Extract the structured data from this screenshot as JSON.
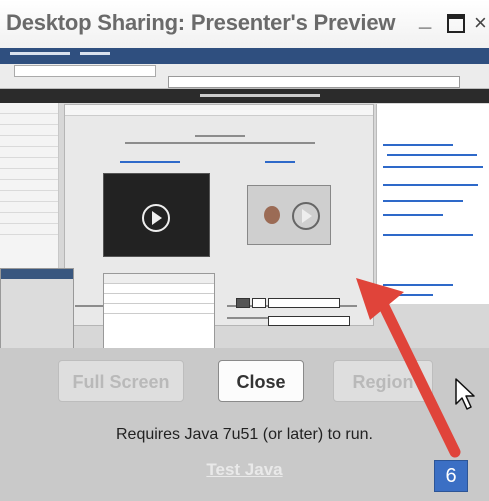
{
  "window": {
    "title": "Desktop Sharing: Presenter's Preview",
    "minimize_symbol": "_",
    "close_symbol": "×"
  },
  "controls": {
    "full_screen_label": "Full Screen",
    "close_label": "Close",
    "region_label": "Region",
    "requirement_text": "Requires Java 7u51 (or later) to run.",
    "test_java_link": "Test Java"
  },
  "annotation": {
    "step_number": "6",
    "arrow_color": "#e0443a",
    "badge_color": "#3b6fc4"
  },
  "icons": {
    "cursor": "mouse-pointer-icon",
    "arrow": "red-arrow-icon"
  }
}
